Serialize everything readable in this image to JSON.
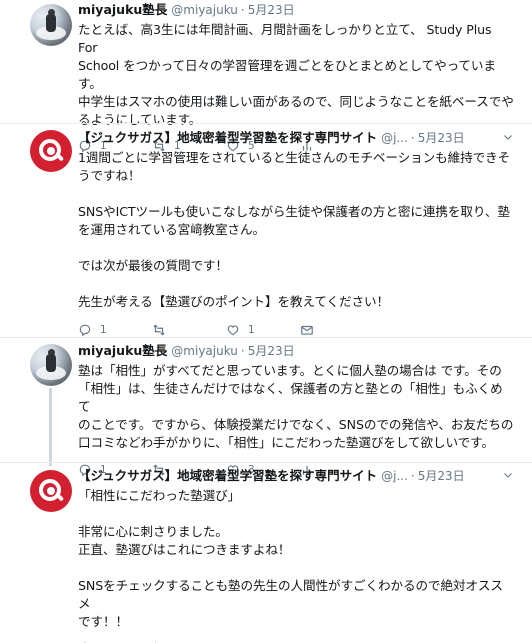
{
  "tweets": [
    {
      "name": "miyajuku塾長",
      "handle": "@miyajuku",
      "sep": "·",
      "date": "5月23日",
      "text": "たとえば、高3生には年間計画、月間計画をしっかりと立て、 Study Plus For\nSchool をつかって日々の学習管理を週ごとをひとまとめとしてやっています。\n中学生はスマホの使用は難しい面があるので、同じようなことを紙ベースでや\nるようにしています。",
      "reply_count": "1",
      "retweet_count": "1",
      "like_count": "5"
    },
    {
      "name": "【ジュクサガス】地域密着型学習塾を探す専門サイト",
      "handle": "@j...",
      "sep": "·",
      "date": "5月23日",
      "text": "1週間ごとに学習管理をされていると生徒さんのモチベーションも維持できそ\nうですね！\n\nSNSやICTツールも使いこなしながら生徒や保護者の方と密に連携を取り、塾\nを運用されている宮﨑教室さん。\n\nでは次が最後の質問です！\n\n先生が考える【塾選びのポイント】を教えてください！",
      "reply_count": "1",
      "retweet_count": "",
      "like_count": "1"
    },
    {
      "name": "miyajuku塾長",
      "handle": "@miyajuku",
      "sep": "·",
      "date": "5月23日",
      "text": "塾は「相性」がすべてだと思っています。とくに個人塾の場合は です。その\n「相性」は、生徒さんだけではなく、保護者の方と塾との「相性」もふくめて\nのことです。ですから、体験授業だけでなく、SNSのでの発信や、お友だちの\n口コミなどわ手がかりに、「相性」にこだわった塾選びをして欲しいです。",
      "reply_count": "1",
      "retweet_count": "",
      "like_count": "3"
    },
    {
      "name": "【ジュクサガス】地域密着型学習塾を探す専門サイト",
      "handle": "@j...",
      "sep": "·",
      "date": "5月23日",
      "text": "「相性にこだわった塾選び」\n\n非常に心に刺さりました。\n正直、塾選びはこれにつきますよね！\n\nSNSをチェックすることも塾の先生の人間性がすごくわかるので絶対オススメ\nです！！",
      "reply_count": "1",
      "retweet_count": "",
      "like_count": ""
    }
  ],
  "colors": {
    "muted": "#657786",
    "divider": "#e6ecf0",
    "thread": "#ccd6dd",
    "brand_red": "#d32030"
  },
  "icons": [
    "reply-icon",
    "retweet-icon",
    "like-icon",
    "analytics-icon",
    "message-icon",
    "chevron-down-icon"
  ]
}
